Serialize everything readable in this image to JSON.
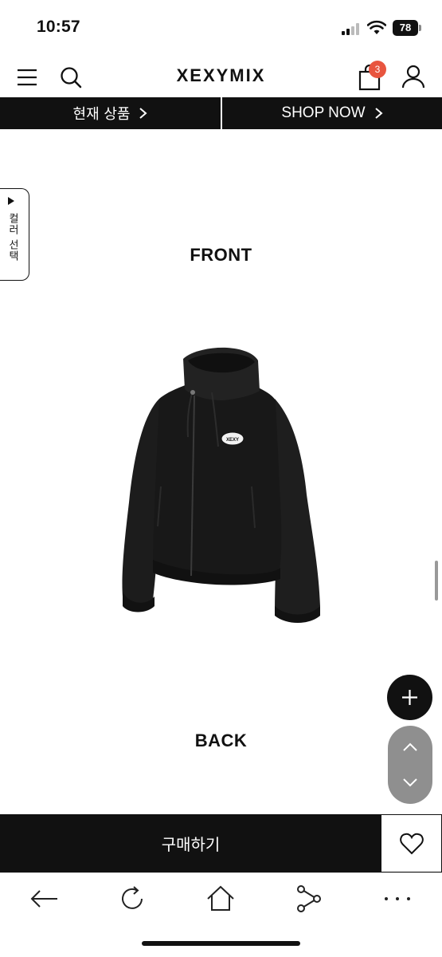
{
  "status_bar": {
    "time": "10:57",
    "battery": "78"
  },
  "header": {
    "logo": "XEXYMIX",
    "cart_count": "3"
  },
  "tabs": {
    "current_product": "현재 상품",
    "shop_now": "SHOP NOW"
  },
  "side_tab": {
    "label": "컬러 선택"
  },
  "sections": {
    "front": "FRONT",
    "back": "BACK",
    "jacket_badge": "XEXY"
  },
  "buy_bar": {
    "buy_label": "구매하기"
  },
  "icons": [
    "menu-icon",
    "search-icon",
    "cart-icon",
    "user-icon",
    "chevron-right-icon",
    "plus-icon",
    "chevron-up-icon",
    "chevron-down-icon",
    "heart-icon",
    "back-arrow-icon",
    "refresh-icon",
    "home-icon",
    "share-icon",
    "more-icon"
  ],
  "colors": {
    "badge": "#e8553f",
    "primary": "#111111",
    "fab_nav": "#8f8f8f"
  }
}
